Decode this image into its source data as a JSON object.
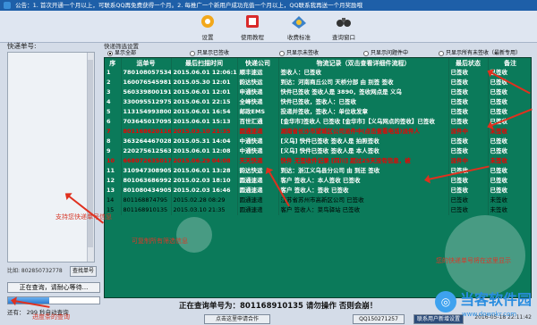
{
  "titlebar": {
    "text": "公告：1. 首次开通一个月以上，可联系QQ再免费获得一个月。2. 每推广一个新用户成功充值一个月以上，QQ联系我再送一个月奖励哦"
  },
  "toolbar": {
    "items": [
      {
        "label": "设置",
        "icon": "gear-icon"
      },
      {
        "label": "使用教程",
        "icon": "tutorial-icon"
      },
      {
        "label": "收费标准",
        "icon": "pricing-icon"
      },
      {
        "label": "查询窗口",
        "icon": "binoculars-icon"
      }
    ]
  },
  "left_panel": {
    "title": "快递单号:",
    "phone_label": "比如: 802850732778",
    "query_label": "查找单号",
    "status": "正在查询，请耐心等待...",
    "progress": 0.45,
    "counter_label": "还有：",
    "counter_value": "299",
    "counter_suffix": "秒自动查询"
  },
  "mode": {
    "label": "快递筛选设置",
    "options": [
      {
        "label": "显示全部",
        "on": true
      },
      {
        "label": "只显示已签收",
        "on": false
      },
      {
        "label": "只显示未签收",
        "on": false
      },
      {
        "label": "只显示问题件中",
        "on": false
      },
      {
        "label": "只显示所有未签收（最新专用）",
        "on": false
      }
    ]
  },
  "table": {
    "headers": [
      "序",
      "运单号",
      "最后扫描时间",
      "快递公司",
      "物流记录（双击查看详细件流程）",
      "最后状态",
      "备注"
    ],
    "rows": [
      {
        "idx": "1",
        "no": "780108057534",
        "time": "2015.06.01 12:06:14",
        "carrier": "顺丰速运",
        "detail": "签收人：已签收",
        "status": "已签收",
        "note": "已签收",
        "style": "r"
      },
      {
        "idx": "2",
        "no": "1600765459814",
        "time": "2015.05.30 12:01",
        "carrier": "韵达快运",
        "detail": "到达：河南商丘公司 天桥分部 由 别签 签收",
        "status": "已签收",
        "note": "已签收",
        "style": "r"
      },
      {
        "idx": "3",
        "no": "560339800191",
        "time": "2015.06.01 12:01",
        "carrier": "申通快递",
        "detail": "快件已签收 签收人是 3890，签收网点是 义乌",
        "status": "已签收",
        "note": "已签收",
        "style": "r"
      },
      {
        "idx": "4",
        "no": "330095512975",
        "time": "2015.06.01 22:15",
        "carrier": "全峰快递",
        "detail": "快件已签收，签收人：已签收",
        "status": "已签收",
        "note": "已签收",
        "style": "r"
      },
      {
        "idx": "5",
        "no": "1131549938005",
        "time": "2015.06.01 16:54",
        "carrier": "邮政EMS",
        "detail": "投递并签收，签收人：单位收发章",
        "status": "已签收",
        "note": "已签收",
        "style": "r"
      },
      {
        "idx": "6",
        "no": "7036450170959",
        "time": "2015.06.01 15:13",
        "carrier": "百世汇通",
        "detail": "[金华市]签收人 已签收 [金华市]【义乌网点的签收】已签收",
        "status": "已签收",
        "note": "已签收",
        "style": "r"
      },
      {
        "idx": "7",
        "no": "801168620116",
        "time": "2015.03.10 21:35",
        "carrier": "圆通速递",
        "detail": "湖南省长沙市望城区公司派件中(点击查看电话)派件人",
        "status": "派件中",
        "note": "未签收",
        "style": "c-red"
      },
      {
        "idx": "8",
        "no": "363264467028",
        "time": "2015.05.31 14:04",
        "carrier": "中通快递",
        "detail": "[义乌] 快件已签收 签收人是 拍照签收",
        "status": "已签收",
        "note": "已签收",
        "style": "r"
      },
      {
        "idx": "9",
        "no": "220275612563",
        "time": "2015.06.01 12:08",
        "carrier": "中通快递",
        "detail": "[义乌] 快件已签收 签收人是 本人签收",
        "status": "已签收",
        "note": "已签收",
        "style": "r"
      },
      {
        "idx": "10",
        "no": "668072635017",
        "time": "2015.06.29 04:08",
        "carrier": "天天快递",
        "detail": "快件 无签收件记录 [四川] 超过25天没有信息，被",
        "status": "派件中",
        "note": "未签收",
        "style": "c-red"
      },
      {
        "idx": "11",
        "no": "310947308905",
        "time": "2015.06.01 13:28",
        "carrier": "韵达快运",
        "detail": "到达：浙江义乌县分公司 由 到还 签收",
        "status": "已签收",
        "note": "已签收",
        "style": "r"
      },
      {
        "idx": "12",
        "no": "801063686992",
        "time": "2015.02.03 18:10",
        "carrier": "圆通速递",
        "detail": "客户 签收人：本人签收 已签收",
        "status": "已签收",
        "note": "已签收",
        "style": "r"
      },
      {
        "idx": "13",
        "no": "801080434905",
        "time": "2015.02.03 16:46",
        "carrier": "圆通速递",
        "detail": "客户 签收人：签收 已签收",
        "status": "已签收",
        "note": "已签收",
        "style": "r"
      },
      {
        "idx": "14",
        "no": "801168874795",
        "time": "2015.02.28 08:29",
        "carrier": "圆通速递",
        "detail": "江苏省苏州市高新区公司 已签收",
        "status": "已签收",
        "note": "未签收",
        "style": "c-black"
      },
      {
        "idx": "15",
        "no": "801168910135",
        "time": "2015.03.10 21:35",
        "carrier": "圆通速递",
        "detail": "客户 签收人：菜鸟驿站 已签收",
        "status": "已签收",
        "note": "未签收",
        "style": "c-black"
      }
    ]
  },
  "footer": {
    "now_label": "正在查询单号为：801168910135  请勿操作 否则会崩！",
    "buttons": [
      {
        "label": "点击这里申请合作",
        "dark": false
      },
      {
        "label": "QQ150271257",
        "dark": false
      },
      {
        "label": "联系用户新增设置",
        "dark": true
      }
    ],
    "timestamp": "2016-05-18 22:11:42"
  },
  "annotations": [
    "支持您快递单号信息",
    "可复制所有筛选信息",
    "您的快递单号将在这里显示",
    "进度条的查询"
  ],
  "watermark": {
    "brand": "当客软件园",
    "url": "www.downkr.com"
  },
  "colors": {
    "grid_bg": "#0b7a5a",
    "alert": "#e00000",
    "title_bg": "#1e5fa8"
  }
}
